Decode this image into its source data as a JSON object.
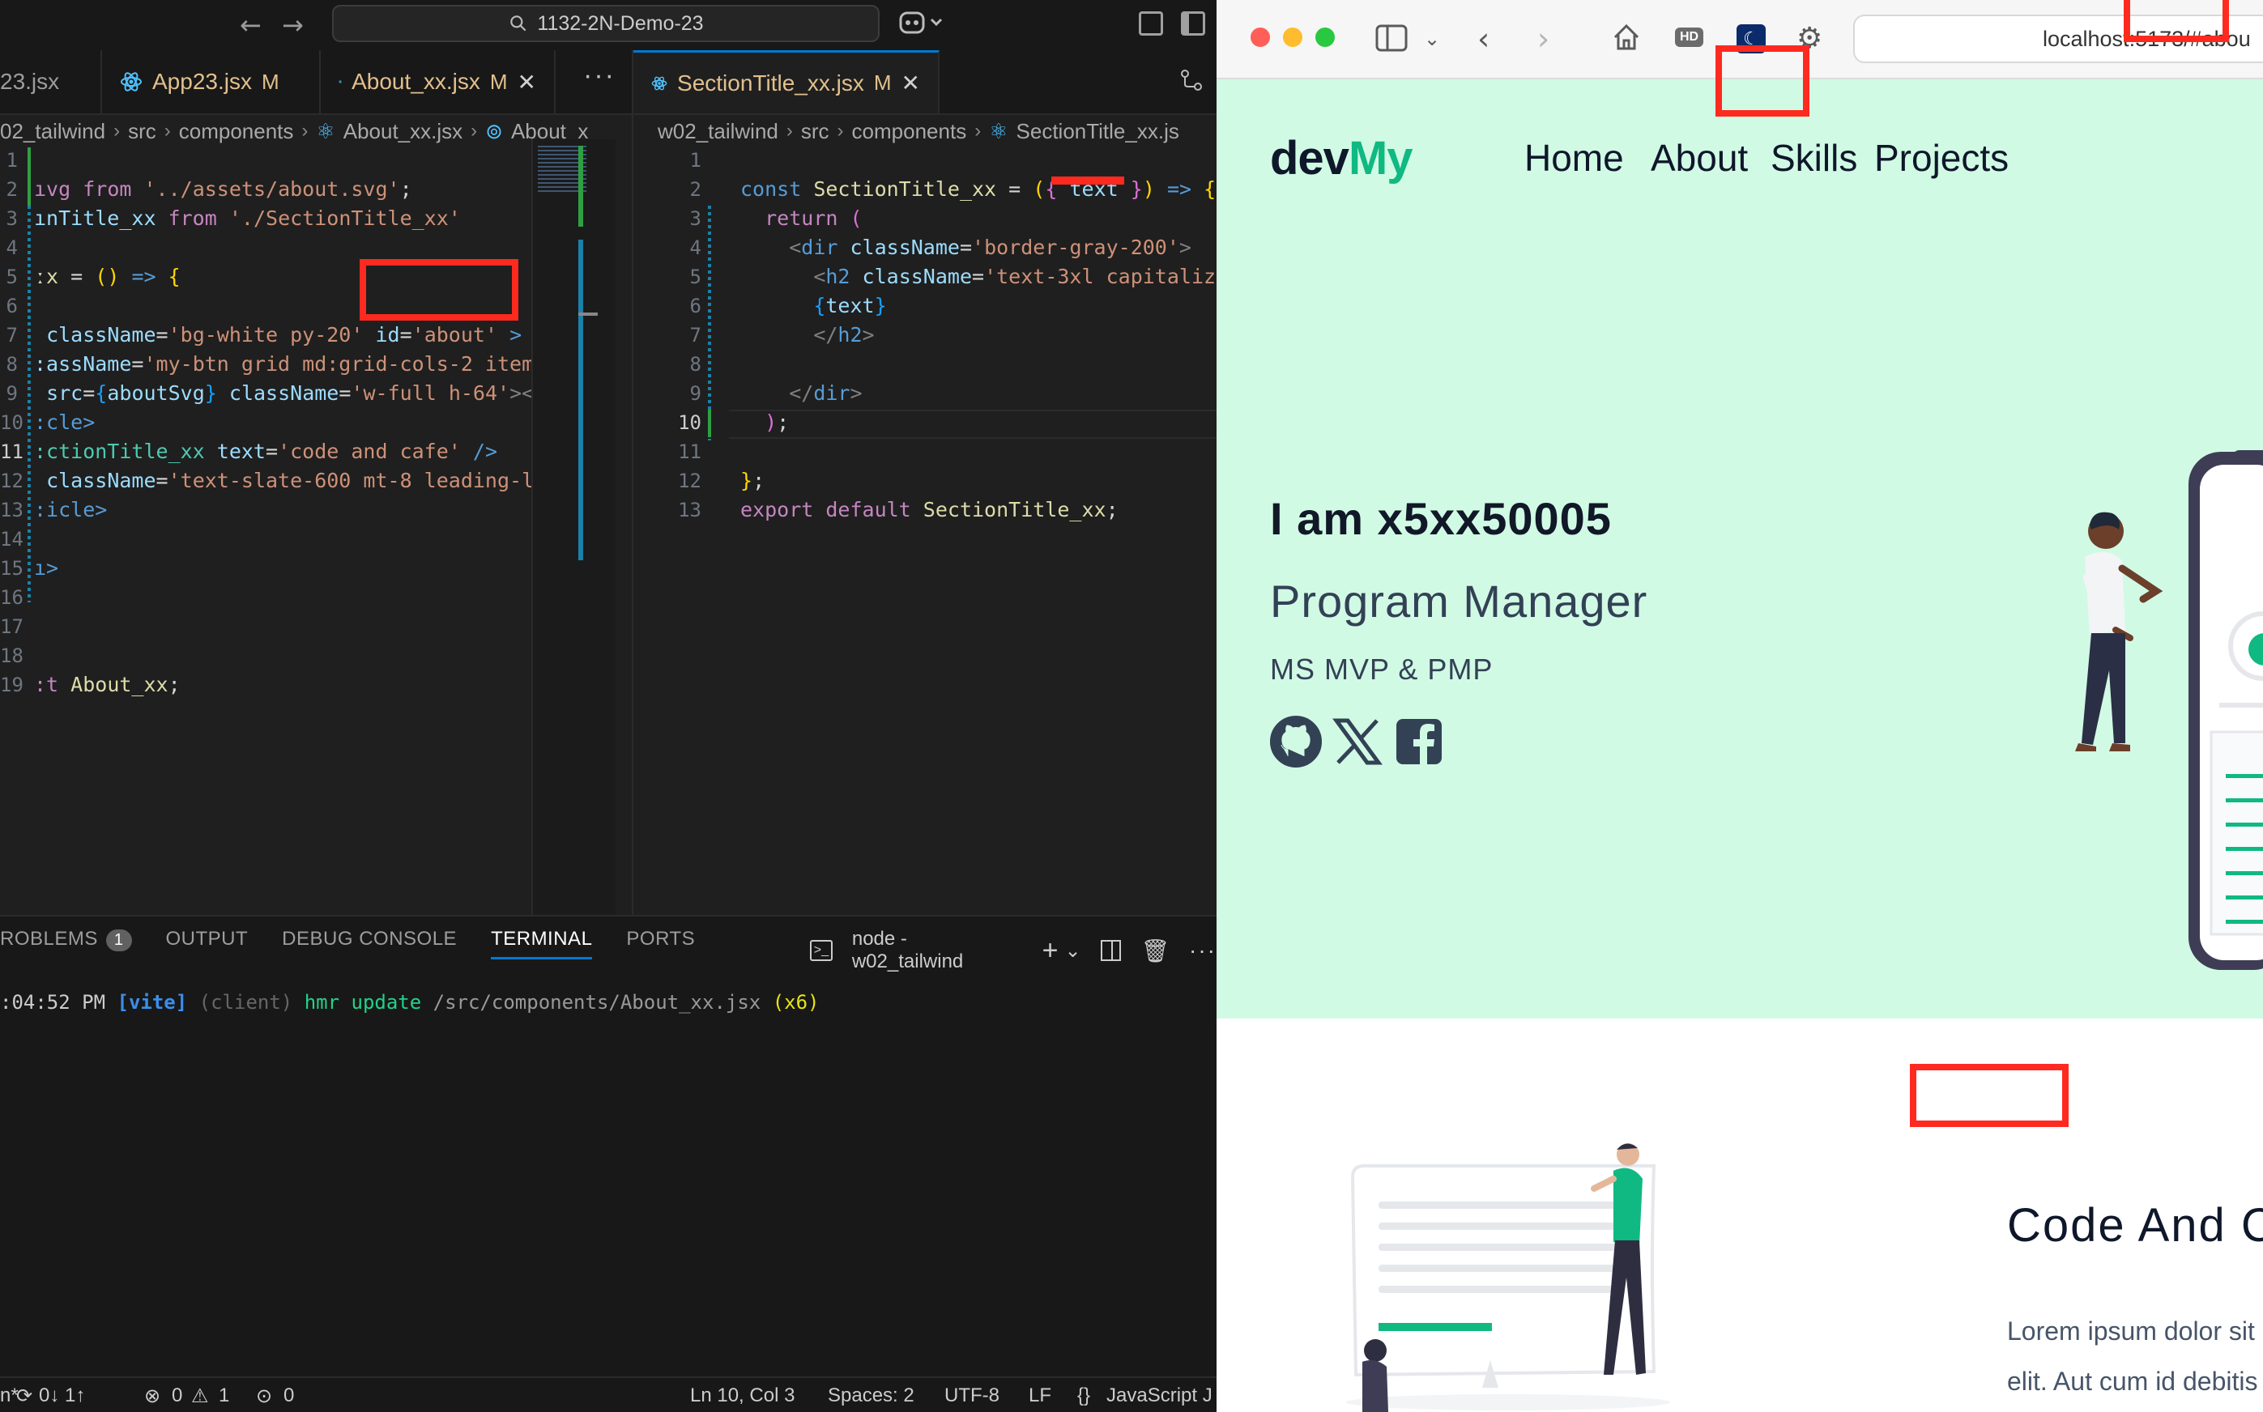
{
  "vscode": {
    "search_text": "1132-2N-Demo-23",
    "left_tabs": [
      {
        "name": "23.jsx",
        "mod": ""
      },
      {
        "name": "App23.jsx",
        "mod": "M"
      },
      {
        "name": "About_xx.jsx",
        "mod": "M"
      }
    ],
    "right_tab": {
      "name": "SectionTitle_xx.jsx",
      "mod": "M"
    },
    "left_crumbs": [
      "02_tailwind",
      "src",
      "components",
      "About_xx.jsx",
      "About_x"
    ],
    "right_crumbs": [
      "w02_tailwind",
      "src",
      "components",
      "SectionTitle_xx.js"
    ],
    "left_line_numbers": [
      "1",
      "2",
      "3",
      "4",
      "5",
      "6",
      "7",
      "8",
      "9",
      "10",
      "11",
      "12",
      "13",
      "14",
      "15",
      "16",
      "17",
      "18",
      "19"
    ],
    "right_line_numbers": [
      "1",
      "2",
      "3",
      "4",
      "5",
      "6",
      "7",
      "8",
      "9",
      "10",
      "11",
      "12",
      "13"
    ],
    "panel": {
      "tabs": [
        "ROBLEMS",
        "OUTPUT",
        "DEBUG CONSOLE",
        "TERMINAL",
        "PORTS"
      ],
      "problems_count": "1",
      "terminal_name": "node - w02_tailwind",
      "terminal_line": {
        "time": ":04:52 PM",
        "tag": "[vite]",
        "client": "(client)",
        "msg": "hmr update",
        "path": "/src/components/About_xx.jsx",
        "count": "(x6)"
      }
    },
    "status": {
      "left": "n*",
      "sync": "0↓ 1↑",
      "errors": "0",
      "warnings": "1",
      "ports": "0",
      "position": "Ln 10, Col 3",
      "spaces": "Spaces: 2",
      "encoding": "UTF-8",
      "eol": "LF",
      "language": "JavaScript J"
    }
  },
  "browser": {
    "url": "localhost:5173/#abou",
    "logo_main": "dev",
    "logo_accent": "My",
    "nav": [
      "Home",
      "About",
      "Skills",
      "Projects"
    ],
    "hero_title": "I am x5xx50005",
    "hero_role": "Program Manager",
    "hero_sub": "MS MVP & PMP",
    "section_title": "Code And C",
    "lorem_1": "Lorem ipsum dolor sit",
    "lorem_2": "elit. Aut cum id debitis"
  },
  "colors": {
    "accent_green": "#10b981",
    "hero_bg": "#d1fae5",
    "annotation_red": "#ff2a1f",
    "vscode_blue": "#0078d4"
  }
}
